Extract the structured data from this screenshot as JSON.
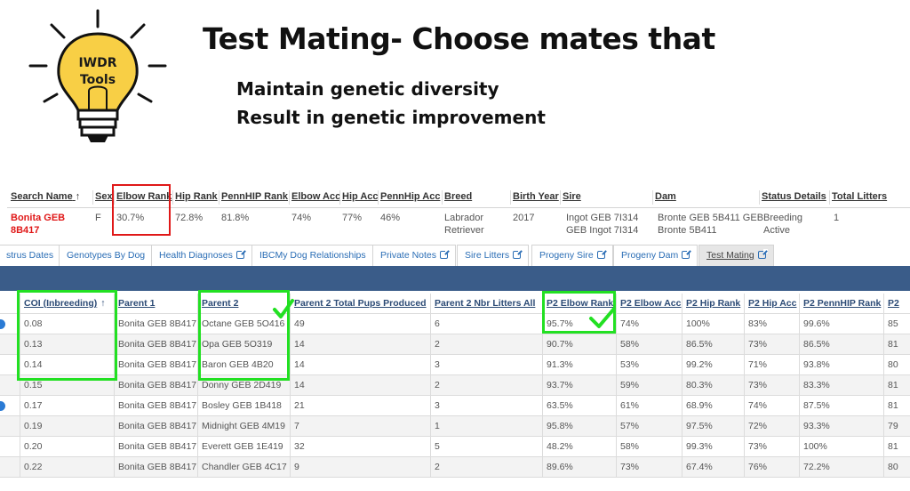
{
  "slide": {
    "bulb_label_line1": "IWDR",
    "bulb_label_line2": "Tools",
    "title": "Test Mating- Choose mates that",
    "bullet1": "Maintain genetic diversity",
    "bullet2": "Result in genetic improvement"
  },
  "summary": {
    "headers": [
      "Search Name",
      "Sex",
      "Elbow Rank",
      "Hip Rank",
      "PennHIP Rank",
      "Elbow Acc",
      "Hip Acc",
      "PennHip Acc",
      "Breed",
      "Birth Year",
      "Sire",
      "Dam",
      "Status Details",
      "Total Litters"
    ],
    "sort_arrow": "↑",
    "dog": {
      "name_line1": "Bonita GEB",
      "name_line2": "8B417",
      "sex": "F",
      "elbow_rank": "30.7%",
      "hip_rank": "72.8%",
      "pennhip_rank": "81.8%",
      "elbow_acc": "74%",
      "hip_acc": "77%",
      "pennhip_acc": "46%",
      "breed_line1": "Labrador",
      "breed_line2": "Retriever",
      "birth_year": "2017",
      "sire_line1": "Ingot GEB 7I314",
      "sire_line2": "GEB Ingot 7I314",
      "dam_line1": "Bronte GEB 5B411 GEB",
      "dam_line2": "Bronte 5B411",
      "status_line1": "Breeding",
      "status_line2": "Active",
      "total_litters": "1"
    }
  },
  "tabs": [
    {
      "label": "strus Dates",
      "ext": false
    },
    {
      "label": "Genotypes By Dog",
      "ext": false
    },
    {
      "label": "Health Diagnoses",
      "ext": true
    },
    {
      "label": "IBCMy Dog Relationships",
      "ext": false
    },
    {
      "label": "Private Notes",
      "ext": true
    },
    {
      "label": "Sire Litters",
      "ext": true
    },
    {
      "label": "Progeny Sire",
      "ext": true
    },
    {
      "label": "Progeny Dam",
      "ext": true
    },
    {
      "label": "Test Mating",
      "ext": true,
      "active": true
    }
  ],
  "grid": {
    "headers": [
      "COI (Inbreeding)",
      "Parent 1",
      "Parent 2",
      "Parent 2 Total Pups Produced",
      "Parent 2 Nbr Litters All",
      "P2 Elbow Rank",
      "P2 Elbow Acc",
      "P2 Hip Rank",
      "P2 Hip Acc",
      "P2 PennHIP Rank",
      "P2"
    ],
    "sort_arrow": "↑",
    "rows": [
      [
        "0.08",
        "Bonita GEB 8B417",
        "Octane GEB 5O416",
        "49",
        "6",
        "95.7%",
        "74%",
        "100%",
        "83%",
        "99.6%",
        "85"
      ],
      [
        "0.13",
        "Bonita GEB 8B417",
        "Opa GEB 5O319",
        "14",
        "2",
        "90.7%",
        "58%",
        "86.5%",
        "73%",
        "86.5%",
        "81"
      ],
      [
        "0.14",
        "Bonita GEB 8B417",
        "Baron GEB 4B20",
        "14",
        "3",
        "91.3%",
        "53%",
        "99.2%",
        "71%",
        "93.8%",
        "80"
      ],
      [
        "0.15",
        "Bonita GEB 8B417",
        "Donny GEB 2D419",
        "14",
        "2",
        "93.7%",
        "59%",
        "80.3%",
        "73%",
        "83.3%",
        "81"
      ],
      [
        "0.17",
        "Bonita GEB 8B417",
        "Bosley GEB 1B418",
        "21",
        "3",
        "63.5%",
        "61%",
        "68.9%",
        "74%",
        "87.5%",
        "81"
      ],
      [
        "0.19",
        "Bonita GEB 8B417",
        "Midnight GEB 4M19",
        "7",
        "1",
        "95.8%",
        "57%",
        "97.5%",
        "72%",
        "93.3%",
        "79"
      ],
      [
        "0.20",
        "Bonita GEB 8B417",
        "Everett GEB 1E419",
        "32",
        "5",
        "48.2%",
        "58%",
        "99.3%",
        "73%",
        "100%",
        "81"
      ],
      [
        "0.22",
        "Bonita GEB 8B417",
        "Chandler GEB 4C17",
        "9",
        "2",
        "89.6%",
        "73%",
        "67.4%",
        "76%",
        "72.2%",
        "80"
      ]
    ]
  },
  "colors": {
    "annotation_red": "#e01818",
    "annotation_green": "#22e022",
    "header_bar": "#3a5c89",
    "link_blue": "#2a6db5"
  }
}
